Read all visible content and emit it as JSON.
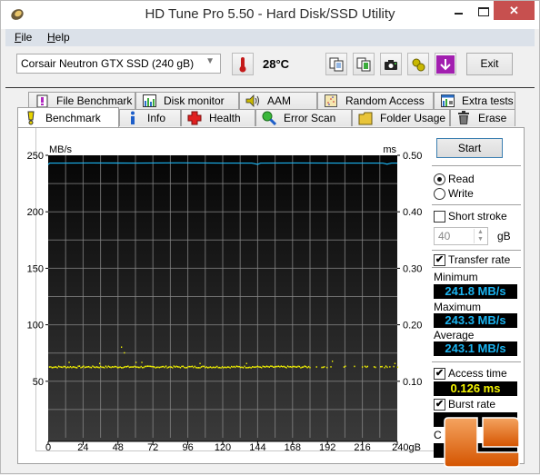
{
  "window": {
    "title": "HD Tune Pro 5.50 - Hard Disk/SSD Utility",
    "close_glyph": "✕"
  },
  "menu": [
    {
      "label": "File",
      "mnemonic": "F",
      "rest": "ile"
    },
    {
      "label": "Help",
      "mnemonic": "H",
      "rest": "elp"
    }
  ],
  "toolbar": {
    "drive": "Corsair Neutron GTX SSD (240 gB)",
    "temperature": "28°C",
    "buttons": [
      "copy-text-icon",
      "copy-screenshot-icon",
      "camera-icon",
      "options-icon",
      "save-icon"
    ],
    "exit_label": "Exit"
  },
  "tabs": {
    "top_row": [
      {
        "label": "File Benchmark",
        "icon": "file-benchmark-icon"
      },
      {
        "label": "Disk monitor",
        "icon": "disk-monitor-icon"
      },
      {
        "label": "AAM",
        "icon": "speaker-icon"
      },
      {
        "label": "Random Access",
        "icon": "random-access-icon"
      },
      {
        "label": "Extra tests",
        "icon": "extra-tests-icon"
      }
    ],
    "bottom_row": [
      {
        "label": "Benchmark",
        "icon": "benchmark-icon",
        "active": true
      },
      {
        "label": "Info",
        "icon": "info-icon"
      },
      {
        "label": "Health",
        "icon": "health-icon"
      },
      {
        "label": "Error Scan",
        "icon": "magnifier-icon"
      },
      {
        "label": "Folder Usage",
        "icon": "folder-icon"
      },
      {
        "label": "Erase",
        "icon": "trash-icon"
      }
    ]
  },
  "controls": {
    "start_label": "Start",
    "read_label": "Read",
    "write_label": "Write",
    "mode": "Read",
    "short_stroke_label": "Short stroke",
    "short_stroke_checked": false,
    "short_stroke_value": "40",
    "short_stroke_unit": "gB",
    "transfer_rate_label": "Transfer rate",
    "transfer_rate_checked": true,
    "minimum_label": "Minimum",
    "minimum_value": "241.8 MB/s",
    "maximum_label": "Maximum",
    "maximum_value": "243.3 MB/s",
    "average_label": "Average",
    "average_value": "243.1 MB/s",
    "access_time_label": "Access time",
    "access_time_checked": true,
    "access_time_value": "0.126 ms",
    "burst_rate_label": "Burst rate",
    "burst_rate_checked": true,
    "cpu_label_partial": "C",
    "check_glyph": "✔"
  },
  "colors": {
    "transfer_line": "#1ab3f0",
    "access_dots": "#f5f500",
    "close_button": "#c7504f"
  },
  "chart_data": {
    "type": "line",
    "title": "",
    "xlabel": "gB",
    "ylabel_left": "MB/s",
    "ylabel_right": "ms",
    "xlim": [
      0,
      240
    ],
    "ylim_left": [
      0,
      250
    ],
    "ylim_right": [
      0,
      0.5
    ],
    "x_ticks": [
      "0",
      "24",
      "48",
      "72",
      "96",
      "120",
      "144",
      "168",
      "192",
      "216",
      "240gB"
    ],
    "y_ticks_left": [
      "250",
      "200",
      "150",
      "100",
      "50"
    ],
    "y_ticks_right": [
      "0.50",
      "0.40",
      "0.30",
      "0.20",
      "0.10"
    ],
    "grid": true,
    "series": [
      {
        "name": "Transfer rate",
        "axis": "left",
        "style": "line",
        "x": [
          0,
          1,
          10,
          30,
          60,
          90,
          120,
          140,
          144,
          146,
          170,
          200,
          230,
          233,
          236,
          240
        ],
        "values": [
          241.8,
          243.1,
          243.1,
          243.2,
          243.1,
          243.3,
          243.1,
          243.1,
          242.0,
          243.1,
          243.2,
          243.1,
          243.1,
          242.2,
          243.1,
          243.1
        ]
      },
      {
        "name": "Access time",
        "axis": "right",
        "style": "scatter",
        "baseline": 0.125,
        "outliers": [
          {
            "x": 50,
            "y": 0.16
          },
          {
            "x": 52,
            "y": 0.15
          },
          {
            "x": 14,
            "y": 0.133
          },
          {
            "x": 35,
            "y": 0.131
          },
          {
            "x": 60,
            "y": 0.133
          },
          {
            "x": 64,
            "y": 0.133
          },
          {
            "x": 104,
            "y": 0.131
          },
          {
            "x": 136,
            "y": 0.131
          },
          {
            "x": 195,
            "y": 0.135
          },
          {
            "x": 238,
            "y": 0.131
          }
        ]
      }
    ]
  }
}
